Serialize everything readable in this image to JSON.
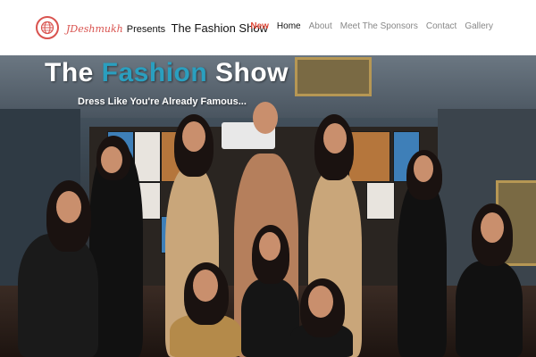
{
  "brand": {
    "script_name": "JDeshmukh",
    "presents": "Presents",
    "title": "The Fashion Show",
    "logo_icon": "globe-icon"
  },
  "nav": {
    "items": [
      {
        "label": "New"
      },
      {
        "label": "Home"
      },
      {
        "label": "About"
      },
      {
        "label": "Meet The Sponsors"
      },
      {
        "label": "Contact"
      },
      {
        "label": "Gallery"
      }
    ]
  },
  "hero": {
    "title_part1": "The ",
    "title_accent": "Fashion",
    "title_part2": " Show",
    "subtitle": "Dress Like You're Already Famous..."
  },
  "colors": {
    "accent_red": "#e04a3a",
    "title_accent_blue": "#2a9fbf"
  }
}
